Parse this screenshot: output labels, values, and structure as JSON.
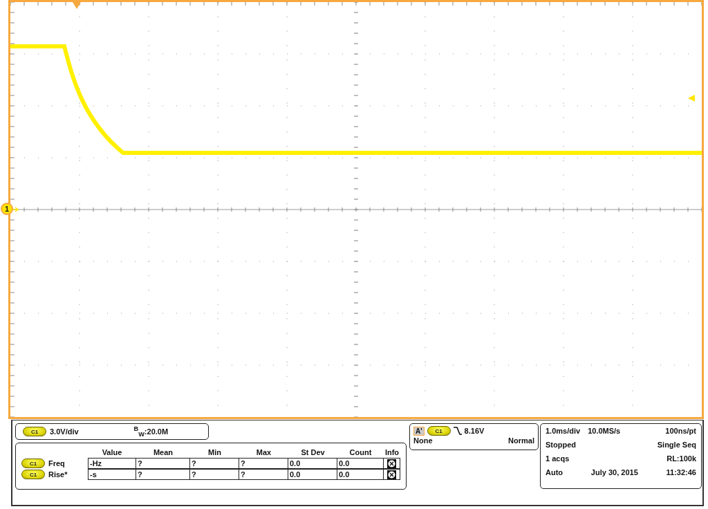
{
  "marker": "1",
  "channel": {
    "badge": "C1",
    "scale": "3.0V/div",
    "bandwidth": "$^{B}$$_{W}$:20.0M"
  },
  "measurements": {
    "columns": [
      "Value",
      "Mean",
      "Min",
      "Max",
      "St Dev",
      "Count",
      "Info"
    ],
    "rows": [
      {
        "badge": "C1",
        "name": "Freq",
        "cells": [
          "-Hz",
          "?",
          "?",
          "?",
          "0.0",
          "0.0"
        ]
      },
      {
        "badge": "C1",
        "name": "Rise*",
        "cells": [
          "-s",
          "?",
          "?",
          "?",
          "0.0",
          "0.0"
        ]
      }
    ]
  },
  "trigger": {
    "source": "A'",
    "badge": "C1",
    "level": "8.16V",
    "coupling": "None",
    "mode": "Normal"
  },
  "acquisition": {
    "rows": [
      [
        "1.0ms/div",
        "10.0MS/s",
        "100ns/pt"
      ],
      [
        "Stopped",
        "Single Seq"
      ],
      [
        "1 acqs",
        "RL:100k"
      ],
      [
        "Auto",
        "July 30, 2015",
        "11:32:46"
      ]
    ]
  }
}
